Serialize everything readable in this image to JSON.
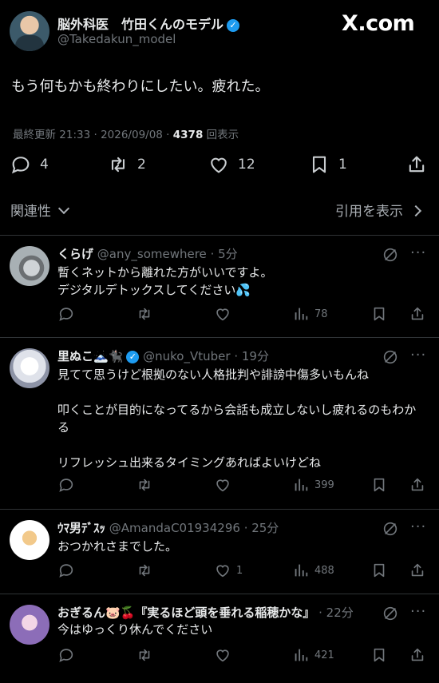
{
  "header": {
    "author_name": "脳外科医　竹田くんのモデル",
    "author_handle": "@Takedakun_model",
    "watermark": "X.com"
  },
  "post": {
    "text": "もう何もかも終わりにしたい。疲れた。",
    "updated": "最終更新 21:33 · 2026/09/08 ·",
    "views_count": "4378",
    "views_label": "回表示",
    "replies": "4",
    "reposts": "2",
    "likes": "12",
    "bookmarks": "1"
  },
  "sort": {
    "label": "関連性",
    "quotes_link": "引用を表示"
  },
  "replies": [
    {
      "name": "くらげ",
      "handle": "@any_somewhere",
      "time": "· 5分",
      "text": "暫くネットから離れた方がいいですよ。\nデジタルデトックスしてください💦",
      "likes": "",
      "views": "78"
    },
    {
      "name": "里ぬこ🗻🐈‍⬛",
      "handle": "@nuko_Vtuber",
      "time": "· 19分",
      "text": "見てて思うけど根拠のない人格批判や誹謗中傷多いもんね\n\n叩くことが目的になってるから会話も成立しないし疲れるのもわかる\n\nリフレッシュ出来るタイミングあればよいけどね",
      "likes": "",
      "views": "399"
    },
    {
      "name": "ｳﾏ男ﾃﾞｽｯ",
      "handle": "@AmandaC01934296",
      "time": "· 25分",
      "text": "おつかれさまでした。",
      "likes": "1",
      "views": "488"
    },
    {
      "name": "おぎるん🐷🍒『実るほど頭を垂れる稲穂かな』",
      "handle": "",
      "time": "· 22分",
      "text": "今はゆっくり休んでください",
      "likes": "",
      "views": "421"
    }
  ]
}
